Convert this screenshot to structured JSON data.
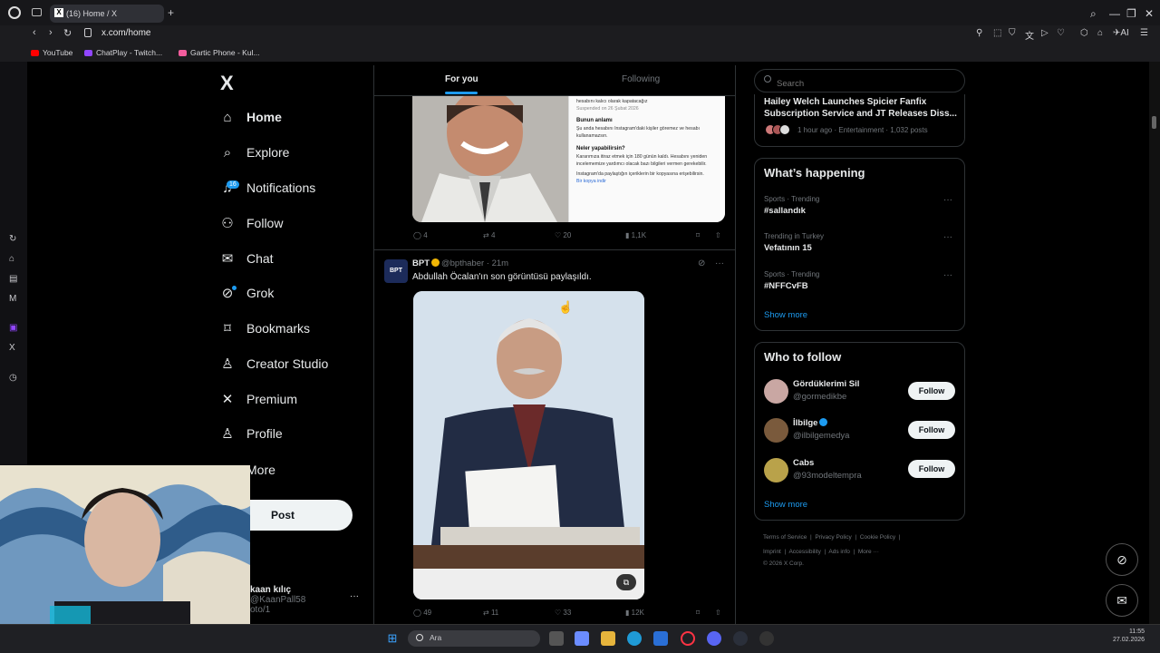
{
  "browser": {
    "tab_title": "(16) Home / X",
    "url": "x.com/home",
    "new_tab_icon": "plus-icon",
    "bookmarks": [
      {
        "label": "YouTube",
        "color": "#ff0000"
      },
      {
        "label": "ChatPlay - Twitch...",
        "color": "#9146ff"
      },
      {
        "label": "Gartic Phone - Kul...",
        "color": "#f25c9c"
      }
    ]
  },
  "nav": {
    "logo": "X",
    "items": [
      {
        "label": "Home",
        "icon": "home-icon"
      },
      {
        "label": "Explore",
        "icon": "search-icon"
      },
      {
        "label": "Notifications",
        "icon": "bell-icon",
        "badge": "16"
      },
      {
        "label": "Follow",
        "icon": "add-user-icon"
      },
      {
        "label": "Chat",
        "icon": "mail-icon"
      },
      {
        "label": "Grok",
        "icon": "grok-icon"
      },
      {
        "label": "Bookmarks",
        "icon": "bookmark-icon"
      },
      {
        "label": "Creator Studio",
        "icon": "creator-icon"
      },
      {
        "label": "Premium",
        "icon": "x-icon"
      },
      {
        "label": "Profile",
        "icon": "person-icon"
      },
      {
        "label": "More",
        "icon": "more-icon"
      }
    ],
    "post_label": "Post",
    "account_name": "kaan kılıç",
    "account_handle": "@KaanPall58",
    "account_overlay": "oto/1"
  },
  "feed": {
    "tab_for_you": "For you",
    "tab_following": "Following",
    "tweet1": {
      "doc_lines": [
        "hesabını kalıcı olarak kapatacağız",
        "Suspended on 26 Şubat 2026"
      ],
      "doc_heading1": "Bunun anlamı",
      "doc_text1": "Şu anda hesabını Instagram'daki kişiler göremez ve hesabı kullanamazsın.",
      "doc_heading2": "Neler yapabilirsin?",
      "doc_text2": "Kararımıza itiraz etmek için 180 günün kaldı. Hesabını yeniden incelememize yardımcı olacak bazı bilgileri vermen gerekebilir.",
      "doc_text3": "Instagram'da paylaştığın içeriklerin bir kopyasına erişebilirsin.",
      "doc_link": "Bir kopya indir",
      "replies": "4",
      "reposts": "4",
      "likes": "20",
      "views": "1,1K"
    },
    "tweet2": {
      "avatar_text": "BPT",
      "name": "BPT",
      "handle": "@bpthaber · 21m",
      "text": "Abdullah Öcalan'ın son görüntüsü paylaşıldı.",
      "replies": "49",
      "reposts": "11",
      "likes": "33",
      "views": "12K"
    }
  },
  "right": {
    "search_placeholder": "Search",
    "news_title": "Hailey Welch Launches Spicier Fanfix Subscription Service and JT Releases Diss...",
    "news_meta": "1 hour ago · Entertainment · 1,032 posts",
    "happening_title": "What’s happening",
    "trends": [
      {
        "meta": "Sports · Trending",
        "name": "#sallandık"
      },
      {
        "meta": "Trending in Turkey",
        "name": "Vefatının 15"
      },
      {
        "meta": "Sports · Trending",
        "name": "#NFFCvFB"
      }
    ],
    "show_more": "Show more",
    "who_title": "Who to follow",
    "follow_label": "Follow",
    "suggestions": [
      {
        "name": "Gördüklerimi Sil",
        "handle": "@gormedikbe",
        "avatar_color": "#c9a7a3"
      },
      {
        "name": "İlbilge",
        "handle": "@ilbilgemedya",
        "avatar_color": "#7a5a3c",
        "verified": true
      },
      {
        "name": "Cabs",
        "handle": "@93modeltempra",
        "avatar_color": "#b9a24a"
      }
    ],
    "footer_row1": [
      "Terms of Service",
      "Privacy Policy",
      "Cookie Policy"
    ],
    "footer_row2": [
      "Imprint",
      "Accessibility",
      "Ads info",
      "More ···"
    ],
    "copyright": "© 2026 X Corp."
  },
  "taskbar": {
    "search_placeholder": "Ara",
    "time": "11:55",
    "date": "27.02.2026"
  }
}
